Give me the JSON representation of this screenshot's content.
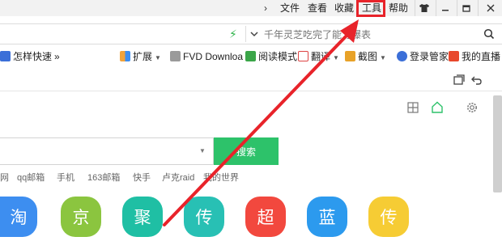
{
  "titlebar": {
    "menu": {
      "file": "文件",
      "view": "查看",
      "favorites": "收藏",
      "tools": "工具",
      "help": "帮助"
    },
    "collapse_glyph": "›"
  },
  "addressbar": {
    "search_placeholder": "千年灵芝吃完了能力爆表"
  },
  "bookmarks": {
    "speed": "怎样快速",
    "more": "»",
    "extensions": "扩展",
    "fvd": "FVD Downloa",
    "reader": "阅读模式",
    "translate": "翻译",
    "screenshot": "截图",
    "login": "登录管家",
    "live": "我的直播"
  },
  "content": {
    "search_button": "搜索",
    "quicklinks": [
      "网",
      "qq邮箱",
      "手机",
      "163邮箱",
      "快手",
      "卢克raid",
      "我的世界"
    ],
    "tiles": [
      {
        "char": "淘",
        "color": "#3d8ef0"
      },
      {
        "char": "京",
        "color": "#8bc53f"
      },
      {
        "char": "聚",
        "color": "#1fbfa4"
      },
      {
        "char": "传",
        "color": "#28c0b4"
      },
      {
        "char": "超",
        "color": "#f2483e"
      },
      {
        "char": "蓝",
        "color": "#2c9aee"
      },
      {
        "char": "传",
        "color": "#f6cc34"
      }
    ]
  },
  "colors": {
    "highlight": "#e8232a",
    "search_button": "#2dc26a",
    "home_icon": "#2dc26a"
  }
}
